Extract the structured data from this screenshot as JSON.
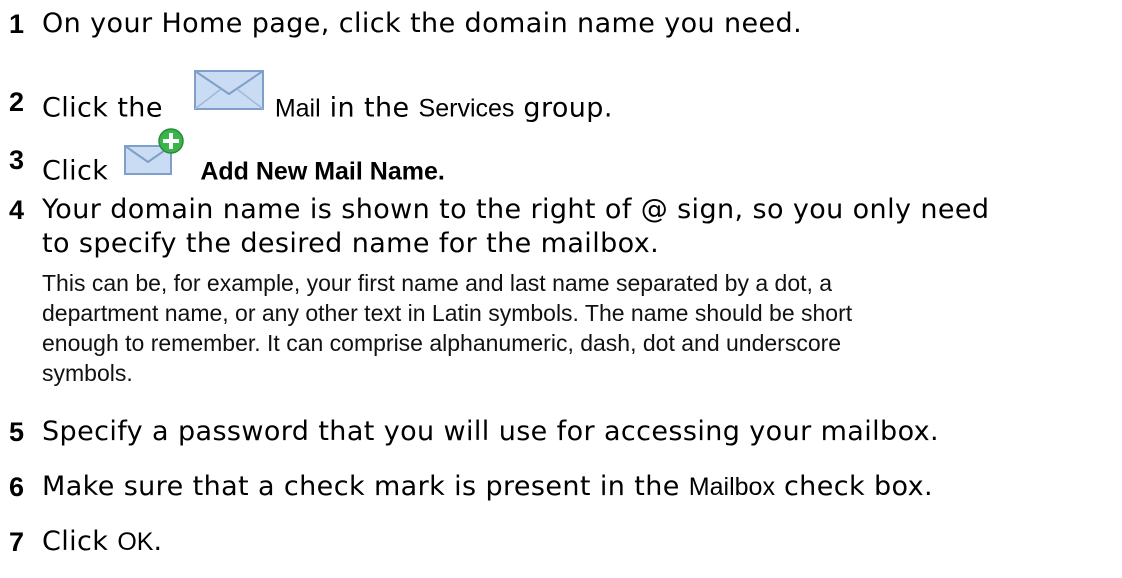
{
  "steps": [
    {
      "number": "1",
      "text": "On your Home page, click the domain name you need."
    },
    {
      "number": "2",
      "before": "Click the",
      "icon": "mail-envelope-icon",
      "ui_label": "Mail",
      "middle": "in the",
      "ui_label_2": "Services",
      "after": "group."
    },
    {
      "number": "3",
      "before": "Click",
      "icon": "add-mail-name-icon",
      "ui_label": "Add New Mail Name",
      "after": "."
    },
    {
      "number": "4",
      "line1": "Your domain name is shown to the right of @ sign, so you only need",
      "line2": "to specify the desired name for the mailbox.",
      "note_line1": "This can be, for example, your first name and last name separated by a dot, a",
      "note_line2": "department name, or any other text in Latin symbols. The name should be short",
      "note_line3": "enough to remember. It can comprise alphanumeric, dash, dot and underscore",
      "note_line4": "symbols."
    },
    {
      "number": "5",
      "text": "Specify a password that you will use for accessing your mailbox."
    },
    {
      "number": "6",
      "before": "Make sure that a check mark is present in the",
      "ui_label": "Mailbox",
      "after": "check box."
    },
    {
      "number": "7",
      "before": "Click",
      "ui_label": "OK",
      "after": "."
    }
  ],
  "colors": {
    "envelope_fill": "#c9dcf3",
    "envelope_stroke": "#7f9fc9",
    "plus_green": "#39b54a"
  }
}
